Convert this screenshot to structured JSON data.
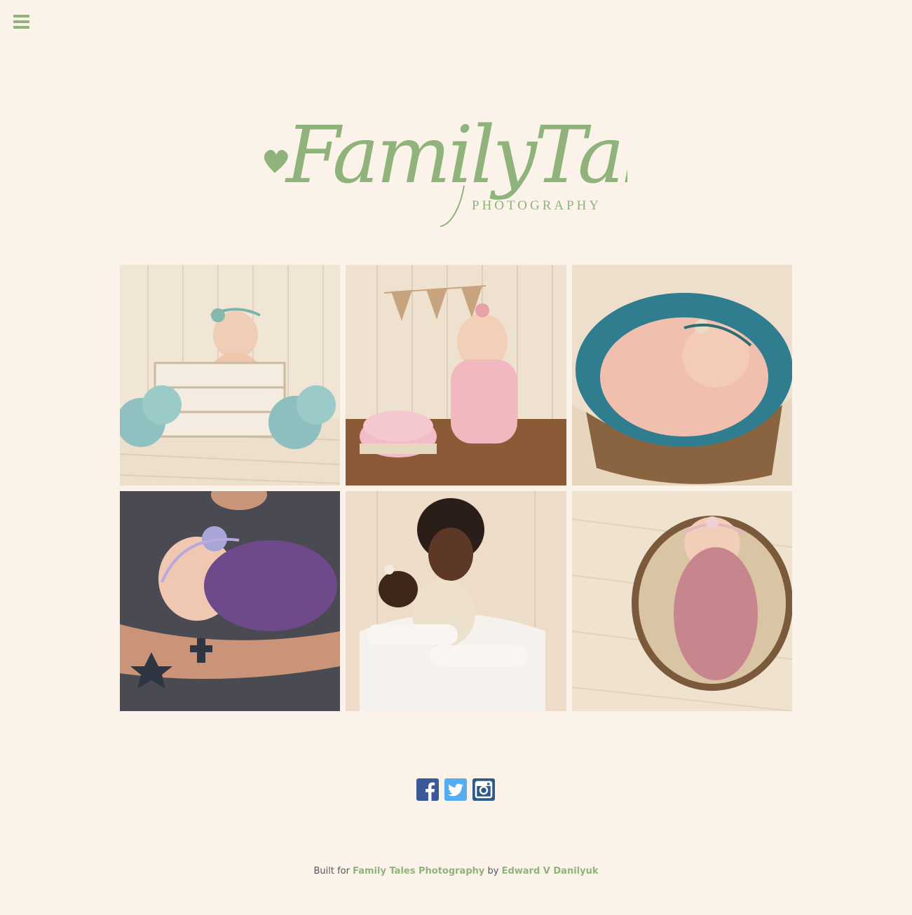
{
  "nav": {
    "menu_icon": "hamburger-menu-icon"
  },
  "logo": {
    "script_text": "FamilyTales",
    "subtitle": "PHOTOGRAPHY",
    "accent_color": "#8fb37a"
  },
  "gallery": {
    "photos": [
      {
        "alt": "baby in white crate with blue hydrangeas"
      },
      {
        "alt": "first birthday cake smash with one banner"
      },
      {
        "alt": "newborn in wooden bowl with teal wool"
      },
      {
        "alt": "father holding newborn in purple wrap"
      },
      {
        "alt": "mother holding newborn"
      },
      {
        "alt": "newborn in pink wrap in wooden bowl"
      }
    ]
  },
  "social": {
    "facebook_icon": "facebook-icon",
    "twitter_icon": "twitter-icon",
    "instagram_icon": "instagram-icon"
  },
  "footer": {
    "built_for": "Built for",
    "client_link": "Family Tales Photography",
    "by": "by",
    "author_link": "Edward V Danilyuk"
  },
  "colors": {
    "background": "#fbf3ea",
    "accent": "#8fb37a",
    "facebook": "#3b5998",
    "twitter": "#55acee",
    "instagram": "#2e5a87"
  }
}
